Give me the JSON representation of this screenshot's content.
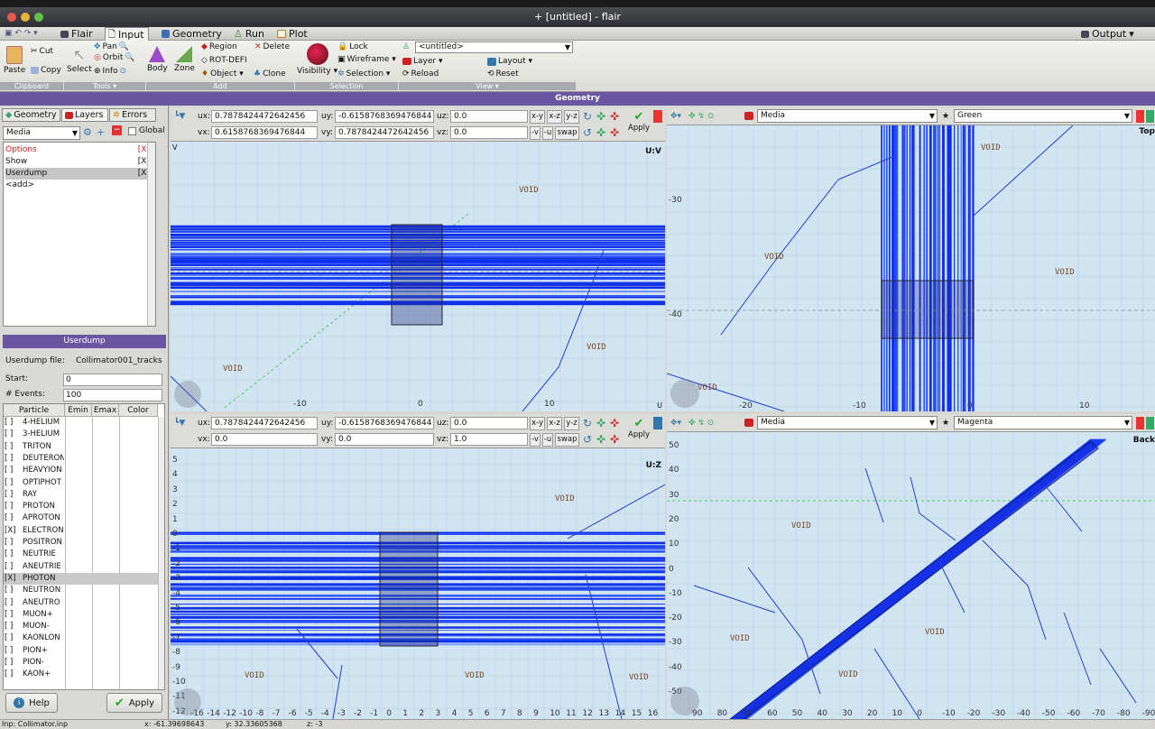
{
  "window": {
    "title": "+ [untitled] - flair"
  },
  "menubar": {
    "flair": "Flair",
    "input": "Input",
    "geometry": "Geometry",
    "run": "Run",
    "plot": "Plot",
    "output": "Output"
  },
  "ribbon": {
    "paste": "Paste",
    "cut": "Cut",
    "copy": "Copy",
    "select": "Select",
    "pan": "Pan",
    "orbit": "Orbit",
    "info": "Info",
    "body": "Body",
    "zone": "Zone",
    "region": "Region",
    "delete": "Delete",
    "rotdefi": "ROT-DEFI",
    "object": "Object ▾",
    "clone": "Clone",
    "visibility": "Visibility ▾",
    "lock": "Lock",
    "wireframe": "Wireframe ▾",
    "selection": "Selection ▾",
    "untitled_combo": "<untitled>",
    "layer": "Layer ▾",
    "layout": "Layout ▾",
    "reload": "Reload",
    "reset": "Reset",
    "groups": {
      "clipboard": "Clipboard",
      "tools": "Tools ▾",
      "add": "Add",
      "selection": "Selection",
      "view": "View ▾"
    }
  },
  "geometry_bar": "Geometry",
  "left_panel": {
    "tabs": [
      "Geometry",
      "Layers",
      "Errors"
    ],
    "media_combo": "Media",
    "global_label": "Global",
    "layers": [
      {
        "name": "Options",
        "flag": "[X]"
      },
      {
        "name": "Show",
        "flag": "[X]"
      },
      {
        "name": "Userdump",
        "flag": "[X]"
      },
      {
        "name": "<add>",
        "flag": ""
      }
    ]
  },
  "userdump": {
    "title": "Userdump",
    "file_label": "Userdump file:",
    "file_value": "Collimator001_tracks",
    "start_label": "Start:",
    "start_value": "0",
    "events_label": "# Events:",
    "events_value": "100",
    "columns": [
      "Particle",
      "Emin",
      "Emax",
      "Color"
    ],
    "particles": [
      {
        "cb": "[ ]",
        "name": "4-HELIUM"
      },
      {
        "cb": "[ ]",
        "name": "3-HELIUM"
      },
      {
        "cb": "[ ]",
        "name": "TRITON"
      },
      {
        "cb": "[ ]",
        "name": "DEUTERON"
      },
      {
        "cb": "[ ]",
        "name": "HEAVYION"
      },
      {
        "cb": "[ ]",
        "name": "OPTIPHOT"
      },
      {
        "cb": "[ ]",
        "name": "RAY"
      },
      {
        "cb": "[ ]",
        "name": "PROTON"
      },
      {
        "cb": "[ ]",
        "name": "APROTON"
      },
      {
        "cb": "[X]",
        "name": "ELECTRON"
      },
      {
        "cb": "[ ]",
        "name": "POSITRON"
      },
      {
        "cb": "[ ]",
        "name": "NEUTRIE"
      },
      {
        "cb": "[ ]",
        "name": "ANEUTRIE"
      },
      {
        "cb": "[X]",
        "name": "PHOTON"
      },
      {
        "cb": "[ ]",
        "name": "NEUTRON"
      },
      {
        "cb": "[ ]",
        "name": "ANEUTRO"
      },
      {
        "cb": "[ ]",
        "name": "MUON+"
      },
      {
        "cb": "[ ]",
        "name": "MUON-"
      },
      {
        "cb": "[ ]",
        "name": "KAONLON"
      },
      {
        "cb": "[ ]",
        "name": "PION+"
      },
      {
        "cb": "[ ]",
        "name": "PION-"
      },
      {
        "cb": "[ ]",
        "name": "KAON+"
      }
    ],
    "help": "Help",
    "apply": "Apply"
  },
  "viewports": {
    "top_left": {
      "ux": "0.7878424472642456",
      "uy": "-0.6158768369476844",
      "uz": "0.0",
      "vx": "0.6158768369476844",
      "vy": "0.7878424472642456",
      "vz": "0.0",
      "corner": "U:V",
      "apply": "Apply",
      "ticks": [
        "-10",
        "0",
        "10"
      ],
      "v_label": "V",
      "u_label": "U",
      "voids": [
        "VOID",
        "VOID",
        "VOID"
      ]
    },
    "top_right": {
      "media": "Media",
      "color": "Green",
      "corner": "Top",
      "x_ticks": [
        "-20",
        "-10",
        "0",
        "10"
      ],
      "y_ticks": [
        "-30",
        "-40"
      ],
      "voids": [
        "VOID",
        "VOID",
        "VOID",
        "VOID"
      ]
    },
    "bottom_left": {
      "ux": "0.7878424472642456",
      "uy": "-0.6158768369476844",
      "uz": "0.0",
      "vx": "0.0",
      "vy": "0.0",
      "vz": "1.0",
      "corner": "U:Z",
      "apply": "Apply",
      "x_ticks": [
        "-16",
        "-14",
        "-12",
        "-10",
        "-8",
        "-7",
        "-6",
        "-5",
        "-4",
        "-3",
        "-2",
        "-1",
        "0",
        "1",
        "2",
        "3",
        "4",
        "5",
        "6",
        "7",
        "8",
        "9",
        "10",
        "11",
        "12",
        "13",
        "14",
        "15",
        "16"
      ],
      "y_ticks": [
        "5",
        "4",
        "3",
        "2",
        "1",
        "0",
        "-1",
        "-2",
        "-3",
        "-4",
        "-5",
        "-6",
        "-7",
        "-8",
        "-9",
        "-10",
        "-11",
        "-12"
      ],
      "voids": [
        "VOID",
        "VOID",
        "VOID",
        "VOID"
      ]
    },
    "bottom_right": {
      "media": "Media",
      "color": "Magenta",
      "corner": "Back",
      "x_ticks": [
        "90",
        "80",
        "70",
        "60",
        "50",
        "40",
        "30",
        "20",
        "10",
        "0",
        "-10",
        "-20",
        "-30",
        "-40",
        "-50",
        "-60",
        "-70",
        "-80",
        "-90"
      ],
      "y_ticks": [
        "50",
        "40",
        "30",
        "20",
        "10",
        "0",
        "-10",
        "-20",
        "-30",
        "-40",
        "-50"
      ],
      "voids": [
        "VOID",
        "VOID",
        "VOID",
        "VOID"
      ]
    }
  },
  "statusbar": {
    "file": "Inp: Collimator.inp",
    "x": "x: -61.39698643",
    "y": "y: 32.33605368",
    "z": "z: -3"
  },
  "buttons": {
    "xy": "x-y",
    "xz": "x-z",
    "yz": "y-z",
    "negv": "-v",
    "negu": "-u",
    "swap": "swap"
  },
  "labels": {
    "ux": "ux:",
    "uy": "uy:",
    "uz": "uz:",
    "vx": "vx:",
    "vy": "vy:",
    "vz": "vz:"
  }
}
